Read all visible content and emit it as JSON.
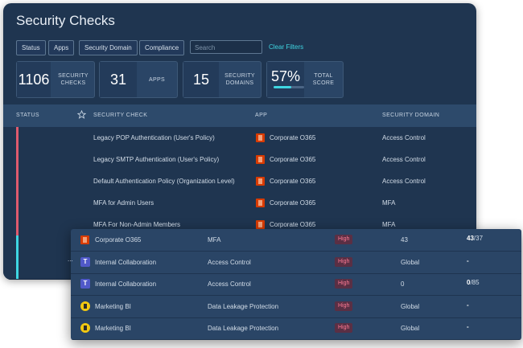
{
  "title": "Security Checks",
  "filters": {
    "buttons": [
      "Status",
      "Apps",
      "Security Domain",
      "Compliance"
    ],
    "search_placeholder": "Search",
    "clear_label": "Clear Filters"
  },
  "stats": [
    {
      "value": "1106",
      "label1": "SECURITY",
      "label2": "CHECKS"
    },
    {
      "value": "31",
      "label1": "APPS",
      "label2": ""
    },
    {
      "value": "15",
      "label1": "SECURITY",
      "label2": "DOMAINS"
    },
    {
      "value": "57%",
      "label1": "TOTAL",
      "label2": "SCORE",
      "progress": 0.57
    }
  ],
  "table": {
    "headers": {
      "status": "STATUS",
      "check": "SECURITY CHECK",
      "app": "APP",
      "domain": "SECURITY DOMAIN"
    },
    "rows": [
      {
        "check": "Legacy POP Authentication (User's Policy)",
        "app": "Corporate O365",
        "domain": "Access Control",
        "status_color": "#e05a6e"
      },
      {
        "check": "Legacy SMTP Authentication (User's Policy)",
        "app": "Corporate O365",
        "domain": "Access Control",
        "status_color": "#e05a6e"
      },
      {
        "check": "Default Authentication Policy (Organization Level)",
        "app": "Corporate O365",
        "domain": "Access Control",
        "status_color": "#e05a6e"
      },
      {
        "check": "MFA for Admin Users",
        "app": "Corporate O365",
        "domain": "MFA",
        "status_color": "#e05a6e"
      },
      {
        "check": "MFA For Non-Admin Members",
        "app": "Corporate O365",
        "domain": "MFA",
        "status_color": "#e05a6e"
      },
      {
        "check": "",
        "app": "",
        "domain": "",
        "status_color": "#3fd6e2"
      },
      {
        "check": "",
        "app": "",
        "domain": "",
        "status_color": "#3fd6e2"
      }
    ]
  },
  "overlay_rows": [
    {
      "app": "Corporate O365",
      "icon": "office-icon",
      "domain": "MFA",
      "severity": "High",
      "value": "43",
      "ratio_a": "43",
      "ratio_b": "/37"
    },
    {
      "app": "Internal Collaboration",
      "icon": "teams-icon",
      "domain": "Access Control",
      "severity": "High",
      "value": "Global",
      "ratio_a": "-",
      "ratio_b": ""
    },
    {
      "app": "Internal Collaboration",
      "icon": "teams-icon",
      "domain": "Access Control",
      "severity": "High",
      "value": "0",
      "ratio_a": "0",
      "ratio_b": "/85"
    },
    {
      "app": "Marketing BI",
      "icon": "powerbi-icon",
      "domain": "Data Leakage Protection",
      "severity": "High",
      "value": "Global",
      "ratio_a": "-",
      "ratio_b": ""
    },
    {
      "app": "Marketing BI",
      "icon": "powerbi-icon",
      "domain": "Data Leakage Protection",
      "severity": "High",
      "value": "Global",
      "ratio_a": "-",
      "ratio_b": ""
    }
  ],
  "overlay_truncated_check": "..."
}
